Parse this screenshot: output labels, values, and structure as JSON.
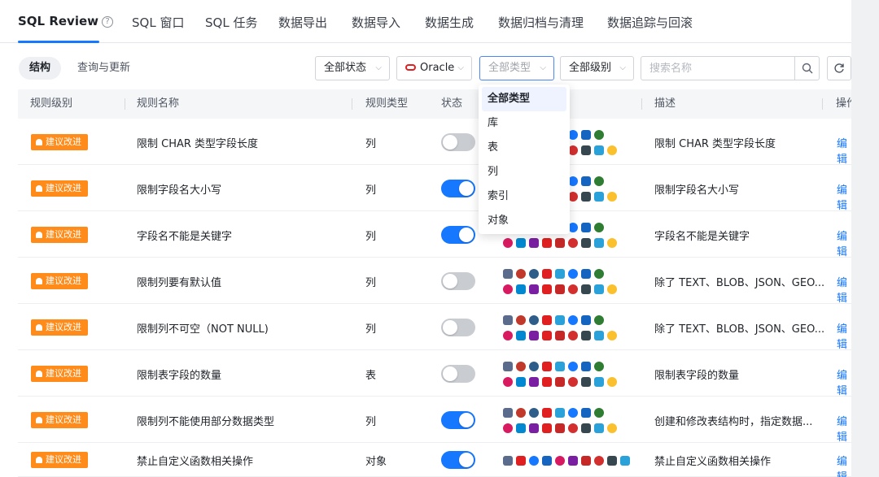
{
  "tabs": [
    {
      "label": "SQL Review",
      "active": true
    },
    {
      "label": "SQL 窗口"
    },
    {
      "label": "SQL 任务"
    },
    {
      "label": "数据导出"
    },
    {
      "label": "数据导入"
    },
    {
      "label": "数据生成"
    },
    {
      "label": "数据归档与清理"
    },
    {
      "label": "数据追踪与回滚"
    }
  ],
  "help_icon": "?",
  "subtabs": {
    "active": "结构",
    "inactive": "查询与更新"
  },
  "filters": {
    "status": "全部状态",
    "dbtype": "Oracle",
    "rule_type": "全部类型",
    "level": "全部级别",
    "search_placeholder": "搜索名称"
  },
  "columns": {
    "level": "规则级别",
    "name": "规则名称",
    "type": "规则类型",
    "status": "状态",
    "support": "",
    "desc": "描述",
    "action": "操作"
  },
  "rows": [
    {
      "level": "建议改进",
      "name": "限制 CHAR 类型字段长度",
      "type": "列",
      "enabled": false,
      "desc": "限制 CHAR 类型字段长度",
      "action": "编辑"
    },
    {
      "level": "建议改进",
      "name": "限制字段名大小写",
      "type": "列",
      "enabled": true,
      "desc": "限制字段名大小写",
      "action": "编辑"
    },
    {
      "level": "建议改进",
      "name": "字段名不能是关键字",
      "type": "列",
      "enabled": true,
      "desc": "字段名不能是关键字",
      "action": "编辑"
    },
    {
      "level": "建议改进",
      "name": "限制列要有默认值",
      "type": "列",
      "enabled": false,
      "desc": "除了 TEXT、BLOB、JSON、GEO...",
      "action": "编辑"
    },
    {
      "level": "建议改进",
      "name": "限制列不可空（NOT NULL)",
      "type": "列",
      "enabled": false,
      "desc": "除了 TEXT、BLOB、JSON、GEO...",
      "action": "编辑"
    },
    {
      "level": "建议改进",
      "name": "限制表字段的数量",
      "type": "表",
      "enabled": false,
      "desc": "限制表字段的数量",
      "action": "编辑"
    },
    {
      "level": "建议改进",
      "name": "限制列不能使用部分数据类型",
      "type": "列",
      "enabled": true,
      "desc": "创建和修改表结构时，指定数据...",
      "action": "编辑"
    },
    {
      "level": "建议改进",
      "name": "禁止自定义函数相关操作",
      "type": "对象",
      "enabled": true,
      "desc": "禁止自定义函数相关操作",
      "action": "编辑"
    }
  ],
  "dropdown": {
    "items": [
      "全部类型",
      "库",
      "表",
      "列",
      "索引",
      "对象"
    ],
    "selected": "全部类型"
  },
  "db_icons": [
    "mysql-icon",
    "mariadb-icon",
    "postgresql-icon",
    "oracle-icon",
    "sqlserver-icon",
    "polardb-icon",
    "oceanbase-icon",
    "tidb-icon",
    "db2-icon",
    "dm-icon",
    "gaussdb-icon",
    "redis-icon",
    "hologres-icon",
    "opengauss-icon",
    "lindorm-icon",
    "clickhouse-icon"
  ],
  "colors": {
    "accent": "#1677ff",
    "badge": "#ff8c1a",
    "oracle": "#e02020"
  }
}
